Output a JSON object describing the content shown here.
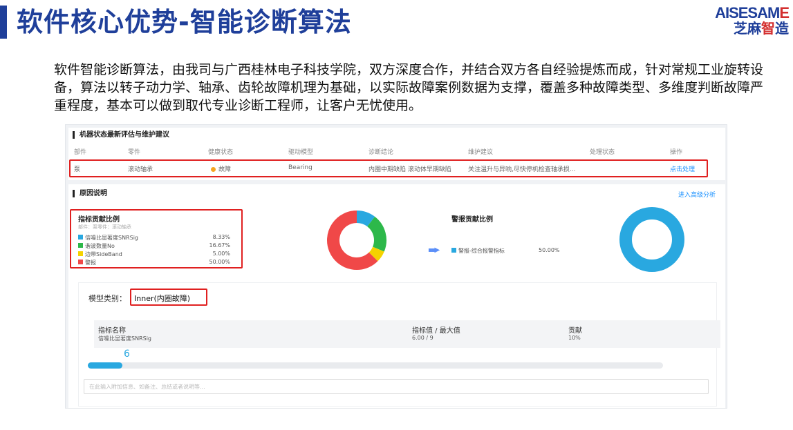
{
  "slide": {
    "title": "软件核心优势-智能诊断算法",
    "logo_en_main": "AISESAM",
    "logo_en_tail": "E",
    "logo_cn_main": "芝麻",
    "logo_cn_red": "智",
    "logo_cn_tail": "造",
    "intro": "软件智能诊断算法，由我司与广西桂林电子科技学院，双方深度合作，并结合双方各自经验提炼而成，针对常规工业旋转设备，算法以转子动力学、轴承、齿轮故障机理为基础，以实际故障案例数据为支撑，覆盖多种故障类型、多维度判断故障严重程度，基本可以做到取代专业诊断工程师，让客户无忧使用。"
  },
  "status_panel": {
    "title": "机器状态最新评估与维护建议",
    "headers": [
      "部件",
      "零件",
      "健康状态",
      "驱动模型",
      "诊断结论",
      "维护建议",
      "处理状态",
      "操作"
    ],
    "row": {
      "part": "泵",
      "component": "滚动轴承",
      "health": "故障",
      "model": "Bearing",
      "conclusion": "内圈中期缺陷 滚动体早期缺陷",
      "advice": "关注温升与异响,尽快停机检查轴承损...",
      "state": "",
      "action": "点击处理"
    }
  },
  "reason_panel": {
    "title": "原因说明",
    "advanced_link": "进入高级分析",
    "contrib": {
      "title": "指标贡献比例",
      "subtitle": "部件：泵零件：滚动轴承",
      "items": [
        {
          "label": "信噪比显著度SNRSig",
          "pct": "8.33%",
          "color": "#29a8e0"
        },
        {
          "label": "谐波数量No",
          "pct": "16.67%",
          "color": "#2db84a"
        },
        {
          "label": "边带SideBand",
          "pct": "5.00%",
          "color": "#f5d300"
        },
        {
          "label": "警报",
          "pct": "50.00%",
          "color": "#f04848"
        }
      ]
    },
    "alarm": {
      "title": "警报贡献比例",
      "item_label": "警报-综合报警指标",
      "item_pct": "50.00%",
      "color": "#29a8e0"
    },
    "model": {
      "label": "模型类别：",
      "value": "Inner(内圈故障)"
    },
    "table": {
      "headers": [
        "指标名称",
        "指标值 / 最大值",
        "贡献"
      ],
      "row": [
        "信噪比显著度SNRSig",
        "6.00 / 9",
        "10%"
      ]
    },
    "gauge": {
      "value_label": "6",
      "fraction": 0.06
    },
    "note_placeholder": "在此输入附加信息、如备注、总结或者说明等..."
  },
  "chart_data": [
    {
      "type": "pie",
      "categories": [
        "信噪比显著度SNRSig",
        "谐波数量No",
        "边带SideBand",
        "警报"
      ],
      "values": [
        8.33,
        16.67,
        5.0,
        50.0
      ],
      "colors": [
        "#29a8e0",
        "#2db84a",
        "#f5d300",
        "#f04848"
      ]
    },
    {
      "type": "pie",
      "categories": [
        "警报-综合报警指标"
      ],
      "values": [
        50.0
      ],
      "colors": [
        "#29a8e0"
      ]
    }
  ]
}
